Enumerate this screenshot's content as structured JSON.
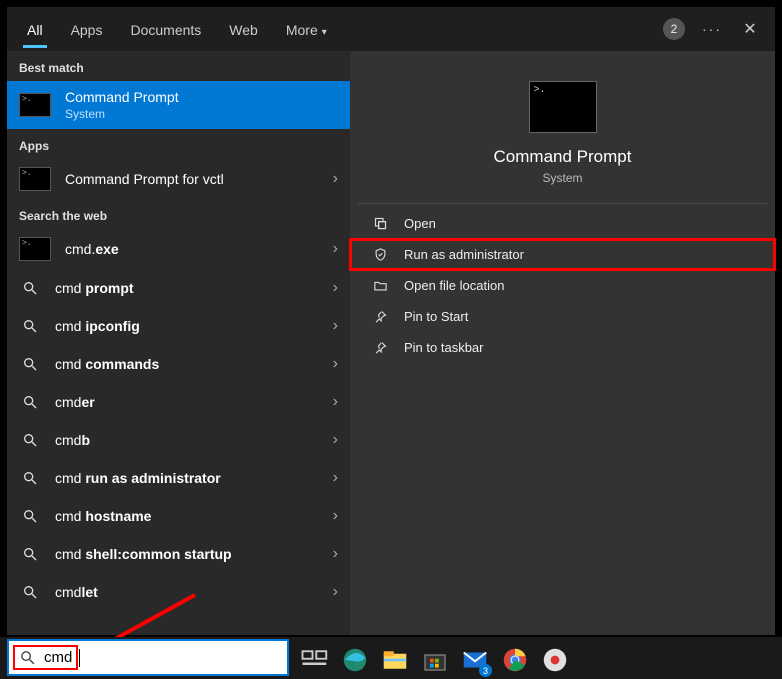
{
  "tabs": {
    "items": [
      "All",
      "Apps",
      "Documents",
      "Web",
      "More"
    ],
    "active_index": 0,
    "recent_count": "2"
  },
  "left": {
    "section_best": "Best match",
    "best_match": {
      "title": "Command Prompt",
      "subtitle": "System"
    },
    "section_apps": "Apps",
    "apps": [
      {
        "plain": "Command Prompt for vctl"
      }
    ],
    "section_web": "Search the web",
    "web": [
      {
        "pre": "cmd.",
        "bold": "exe",
        "icon": "thumb"
      },
      {
        "pre": "cmd ",
        "bold": "prompt",
        "icon": "search"
      },
      {
        "pre": "cmd ",
        "bold": "ipconfig",
        "icon": "search"
      },
      {
        "pre": "cmd ",
        "bold": "commands",
        "icon": "search"
      },
      {
        "pre": "cmd",
        "bold": "er",
        "icon": "search"
      },
      {
        "pre": "cmd",
        "bold": "b",
        "icon": "search"
      },
      {
        "pre": "cmd ",
        "bold": "run as administrator",
        "icon": "search"
      },
      {
        "pre": "cmd ",
        "bold": "hostname",
        "icon": "search"
      },
      {
        "pre": "cmd ",
        "bold": "shell:common startup",
        "icon": "search"
      },
      {
        "pre": "cmd",
        "bold": "let",
        "icon": "search"
      }
    ]
  },
  "right": {
    "title": "Command Prompt",
    "subtitle": "System",
    "actions": [
      {
        "label": "Open",
        "icon": "open"
      },
      {
        "label": "Run as administrator",
        "icon": "shield",
        "highlight": true
      },
      {
        "label": "Open file location",
        "icon": "folder"
      },
      {
        "label": "Pin to Start",
        "icon": "pin"
      },
      {
        "label": "Pin to taskbar",
        "icon": "pin"
      }
    ]
  },
  "searchbox": {
    "query": "cmd"
  },
  "taskbar_icons": [
    "task-view",
    "edge",
    "explorer",
    "store",
    "mail",
    "chrome",
    "app"
  ]
}
